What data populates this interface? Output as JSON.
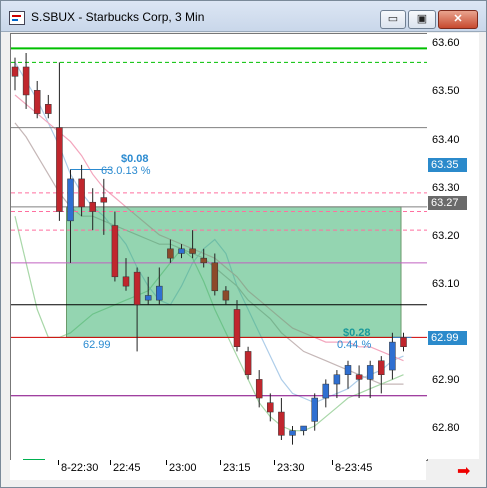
{
  "window": {
    "title": "S.SBUX - Starbucks Corp, 3 Min",
    "controls": {
      "minimize": "▭",
      "maximize": "▣",
      "close": "✕"
    }
  },
  "axis": {
    "price_labels": [
      "63.60",
      "63.50",
      "63.40",
      "63.30",
      "63.20",
      "63.10",
      "62.90",
      "62.80"
    ],
    "price_boxes": [
      {
        "label": "63.35",
        "kind": "blue"
      },
      {
        "label": "63.27",
        "kind": "gray"
      },
      {
        "label": "62.99",
        "kind": "blue"
      }
    ],
    "time_labels": [
      "8-22:30",
      "22:45",
      "23:00",
      "23:15",
      "23:30",
      "8-23:45"
    ]
  },
  "annotations": {
    "measure1_dollar": "$0.08",
    "measure1_pct": "63.0.13 %",
    "measure2_dollar": "$0.28",
    "measure2_pct": "0.44 %",
    "rect_left_price": "62.99"
  },
  "colors": {
    "up": "#2f6fd1",
    "down": "#c0262d",
    "flat": "#8c4a2a",
    "highlight_fill": "#3cb371",
    "measure_text": "#2a8ad0"
  },
  "chart_data": {
    "type": "candlestick",
    "symbol": "S.SBUX",
    "interval": "3 Min",
    "ylim": [
      62.74,
      63.63
    ],
    "candles": [
      {
        "o": 63.57,
        "h": 63.59,
        "l": 63.52,
        "c": 63.55
      },
      {
        "o": 63.57,
        "h": 63.6,
        "l": 63.48,
        "c": 63.51
      },
      {
        "o": 63.52,
        "h": 63.54,
        "l": 63.46,
        "c": 63.47
      },
      {
        "o": 63.49,
        "h": 63.51,
        "l": 63.46,
        "c": 63.47
      },
      {
        "o": 63.44,
        "h": 63.58,
        "l": 63.24,
        "c": 63.26
      },
      {
        "o": 63.24,
        "h": 63.35,
        "l": 63.15,
        "c": 63.33
      },
      {
        "o": 63.33,
        "h": 63.36,
        "l": 63.25,
        "c": 63.27
      },
      {
        "o": 63.28,
        "h": 63.31,
        "l": 63.22,
        "c": 63.26
      },
      {
        "o": 63.29,
        "h": 63.33,
        "l": 63.21,
        "c": 63.28
      },
      {
        "o": 63.23,
        "h": 63.26,
        "l": 63.11,
        "c": 63.12
      },
      {
        "o": 63.12,
        "h": 63.16,
        "l": 63.09,
        "c": 63.1
      },
      {
        "o": 63.13,
        "h": 63.14,
        "l": 62.96,
        "c": 63.06
      },
      {
        "o": 63.07,
        "h": 63.12,
        "l": 63.06,
        "c": 63.08
      },
      {
        "o": 63.07,
        "h": 63.14,
        "l": 63.06,
        "c": 63.1
      },
      {
        "o": 63.18,
        "h": 63.2,
        "l": 63.15,
        "c": 63.16
      },
      {
        "o": 63.17,
        "h": 63.19,
        "l": 63.16,
        "c": 63.18
      },
      {
        "o": 63.18,
        "h": 63.22,
        "l": 63.16,
        "c": 63.17
      },
      {
        "o": 63.16,
        "h": 63.18,
        "l": 63.14,
        "c": 63.15
      },
      {
        "o": 63.15,
        "h": 63.17,
        "l": 63.08,
        "c": 63.09
      },
      {
        "o": 63.09,
        "h": 63.1,
        "l": 63.06,
        "c": 63.07
      },
      {
        "o": 63.05,
        "h": 63.07,
        "l": 62.96,
        "c": 62.97
      },
      {
        "o": 62.96,
        "h": 62.97,
        "l": 62.9,
        "c": 62.91
      },
      {
        "o": 62.9,
        "h": 62.92,
        "l": 62.84,
        "c": 62.86
      },
      {
        "o": 62.85,
        "h": 62.87,
        "l": 62.81,
        "c": 62.83
      },
      {
        "o": 62.83,
        "h": 62.86,
        "l": 62.77,
        "c": 62.78
      },
      {
        "o": 62.78,
        "h": 62.8,
        "l": 62.76,
        "c": 62.79
      },
      {
        "o": 62.79,
        "h": 62.8,
        "l": 62.78,
        "c": 62.8
      },
      {
        "o": 62.81,
        "h": 62.87,
        "l": 62.79,
        "c": 62.86
      },
      {
        "o": 62.86,
        "h": 62.9,
        "l": 62.84,
        "c": 62.89
      },
      {
        "o": 62.89,
        "h": 62.92,
        "l": 62.86,
        "c": 62.91
      },
      {
        "o": 62.91,
        "h": 62.94,
        "l": 62.88,
        "c": 62.93
      },
      {
        "o": 62.91,
        "h": 62.93,
        "l": 62.86,
        "c": 62.9
      },
      {
        "o": 62.9,
        "h": 62.94,
        "l": 62.86,
        "c": 62.93
      },
      {
        "o": 62.94,
        "h": 62.95,
        "l": 62.87,
        "c": 62.91
      },
      {
        "o": 62.92,
        "h": 63.0,
        "l": 62.9,
        "c": 62.98
      },
      {
        "o": 62.99,
        "h": 63.0,
        "l": 62.96,
        "c": 62.97
      }
    ],
    "horizontal_lines": [
      {
        "price": 63.61,
        "color": "#00c000",
        "width": 2
      },
      {
        "price": 63.58,
        "color": "#00c000",
        "dash": true
      },
      {
        "price": 63.44,
        "color": "#808080"
      },
      {
        "price": 63.3,
        "color": "#ff6f9f",
        "dash": true
      },
      {
        "price": 63.27,
        "color": "#808080"
      },
      {
        "price": 63.26,
        "color": "#ff6f9f",
        "dash": true
      },
      {
        "price": 63.22,
        "color": "#ff6f9f",
        "dash": true
      },
      {
        "price": 63.15,
        "color": "#c060c0"
      },
      {
        "price": 63.06,
        "color": "#000000"
      },
      {
        "price": 62.99,
        "color": "#d00000"
      },
      {
        "price": 62.865,
        "color": "#800080"
      }
    ],
    "highlight_box": {
      "top": 63.27,
      "bottom": 62.99,
      "start_index": 5
    },
    "measurements": [
      {
        "from_index": 5,
        "to_index": 8,
        "price": 63.35
      },
      {
        "from_index": 34,
        "to_index": 35,
        "price": 62.99
      }
    ],
    "envelopes": [
      {
        "color": "#aecde9",
        "values": [
          63.58,
          63.54,
          63.5,
          63.45,
          63.4,
          63.34,
          63.3,
          63.27,
          63.25,
          63.22,
          63.19,
          63.14,
          63.1,
          63.07,
          63.06,
          63.1,
          63.15,
          63.18,
          63.2,
          63.17,
          63.1,
          63.05,
          63.0,
          62.95,
          62.9,
          62.87,
          62.86,
          62.85,
          62.86,
          62.87,
          62.88,
          62.9,
          62.91,
          62.92,
          62.94,
          62.95
        ]
      },
      {
        "color": "#f3a6bd",
        "values": [
          63.51,
          63.49,
          63.47,
          63.45,
          63.43,
          63.41,
          63.38,
          63.34,
          63.31,
          63.29,
          63.27,
          63.25,
          63.23,
          63.21,
          63.2,
          63.19,
          63.18,
          63.17,
          63.16,
          63.14,
          63.12,
          63.09,
          63.07,
          63.05,
          63.03,
          63.01,
          63.0,
          62.99,
          62.98,
          62.98,
          62.98,
          62.97,
          62.97,
          62.96,
          62.95,
          62.94
        ]
      },
      {
        "color": "#c5b7b7",
        "values": [
          63.45,
          63.42,
          63.38,
          63.34,
          63.3,
          63.27,
          63.25,
          63.25,
          63.24,
          63.23,
          63.22,
          63.21,
          63.2,
          63.19,
          63.19,
          63.18,
          63.17,
          63.16,
          63.14,
          63.12,
          63.1,
          63.07,
          63.05,
          63.03,
          63.0,
          62.98,
          62.96,
          62.95,
          62.94,
          62.93,
          62.92,
          62.91,
          62.9,
          62.89,
          62.89,
          62.89
        ]
      },
      {
        "color": "#a8d7a8",
        "values": [
          63.25,
          63.15,
          63.05,
          62.99,
          62.99,
          63.0,
          63.02,
          63.04,
          63.05,
          63.06,
          63.07,
          63.08,
          63.09,
          63.12,
          63.15,
          63.18,
          63.16,
          63.11,
          63.05,
          63.0,
          62.95,
          62.9,
          62.85,
          62.82,
          62.8,
          62.79,
          62.79,
          62.8,
          62.82,
          62.84,
          62.86,
          62.87,
          62.88,
          62.89,
          62.9,
          62.91
        ]
      }
    ]
  }
}
